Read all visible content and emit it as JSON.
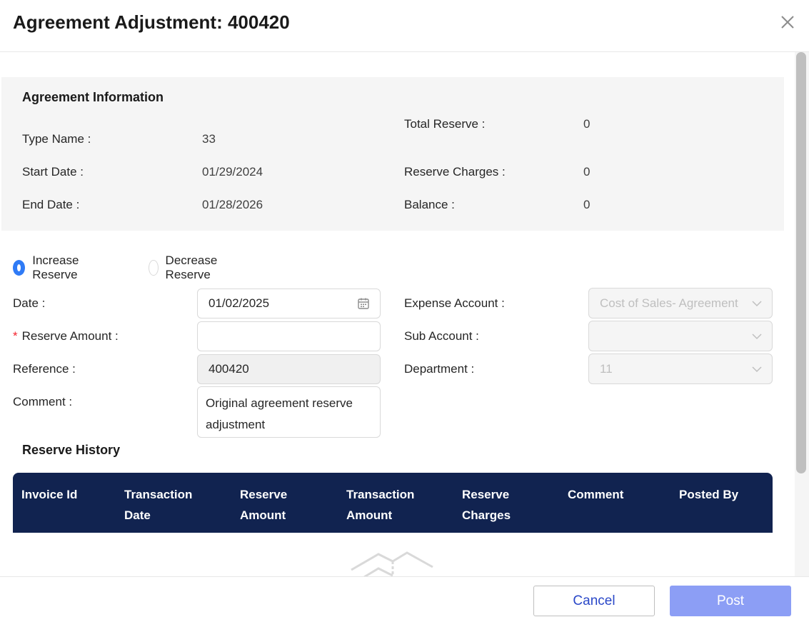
{
  "dialog": {
    "title": "Agreement Adjustment: 400420"
  },
  "info": {
    "title": "Agreement Information",
    "type_name_label": "Type Name :",
    "type_name_value": "33",
    "start_date_label": "Start Date :",
    "start_date_value": "01/29/2024",
    "end_date_label": "End Date :",
    "end_date_value": "01/28/2026",
    "total_reserve_label": "Total Reserve :",
    "total_reserve_value": "0",
    "reserve_charges_label": "Reserve Charges :",
    "reserve_charges_value": "0",
    "balance_label": "Balance :",
    "balance_value": "0"
  },
  "adjustment_type": {
    "increase_label": "Increase Reserve",
    "decrease_label": "Decrease Reserve",
    "selected": "increase"
  },
  "form": {
    "date_label": "Date :",
    "date_value": "01/02/2025",
    "reserve_amount_label": "Reserve Amount :",
    "reserve_amount_required_mark": "*",
    "reserve_amount_value": "",
    "reference_label": "Reference :",
    "reference_value": "400420",
    "comment_label": "Comment :",
    "comment_value": "Original agreement reserve adjustment",
    "expense_account_label": "Expense Account :",
    "expense_account_value": "Cost of Sales- Agreement",
    "sub_account_label": "Sub Account :",
    "sub_account_value": "",
    "department_label": "Department :",
    "department_value": "11"
  },
  "history": {
    "title": "Reserve History",
    "columns": [
      "Invoice Id",
      "Transaction Date",
      "Reserve Amount",
      "Transaction Amount",
      "Reserve Charges",
      "Comment",
      "Posted By"
    ]
  },
  "footer": {
    "cancel_label": "Cancel",
    "post_label": "Post"
  },
  "colors": {
    "accent": "#2f7bf6",
    "table_header": "#112350",
    "post_button": "#8c9ef5",
    "cancel_text": "#2a48c8",
    "required": "#f5222d"
  }
}
